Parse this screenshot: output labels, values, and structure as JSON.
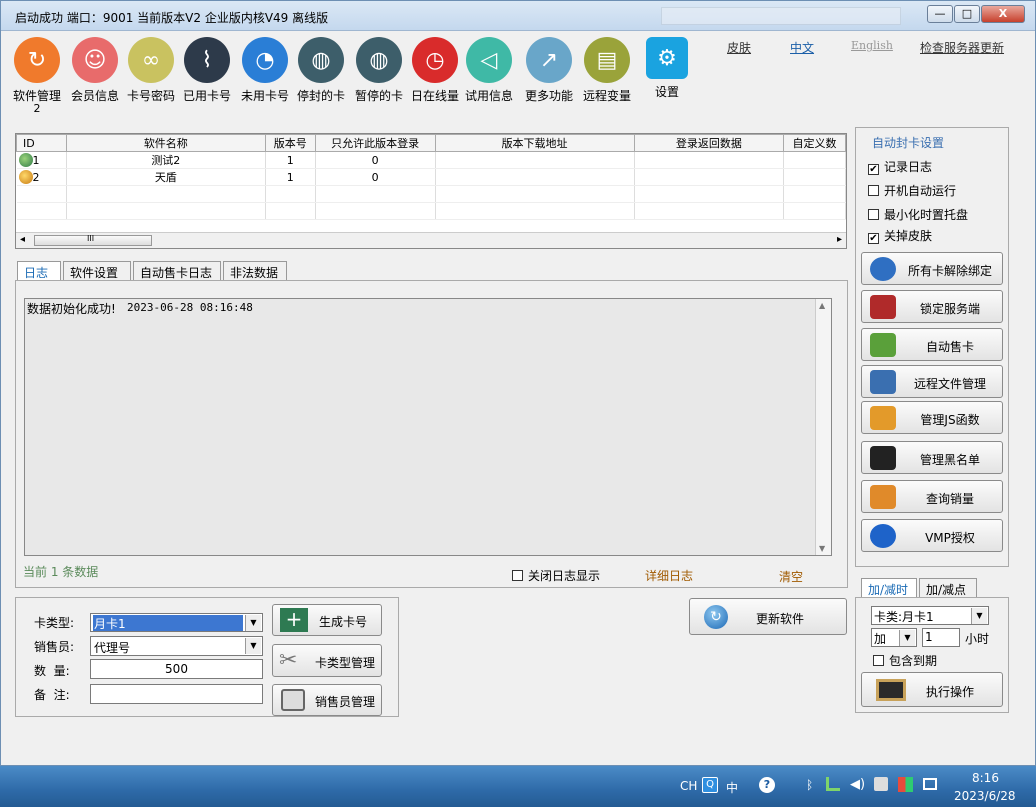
{
  "window": {
    "title": "启动成功  端口：9001  当前版本V2  企业版内核V49    离线版",
    "search_placeholder": "",
    "minimize": "—",
    "maximize": "□",
    "close": "X"
  },
  "toolbar": [
    {
      "label": "软件管理",
      "sub": "2",
      "color": "#f07a2c",
      "icon": "refresh-icon"
    },
    {
      "label": "会员信息",
      "color": "#e86b6b",
      "icon": "users-icon"
    },
    {
      "label": "卡号密码",
      "color": "#c9c260",
      "icon": "chain-icon"
    },
    {
      "label": "已用卡号",
      "color": "#2d3a4a",
      "icon": "paperclip-icon"
    },
    {
      "label": "未用卡号",
      "color": "#2a7ed6",
      "icon": "pie-icon"
    },
    {
      "label": "停封的卡",
      "color": "#3d5e6a",
      "icon": "globe-icon"
    },
    {
      "label": "暂停的卡",
      "color": "#3d5e6a",
      "icon": "globe-icon"
    },
    {
      "label": "日在线量",
      "color": "#d92b2b",
      "icon": "clock-icon"
    },
    {
      "label": "试用信息",
      "color": "#3fb9a6",
      "icon": "megaphone-icon"
    },
    {
      "label": "更多功能",
      "color": "#69a6c9",
      "icon": "chart-icon"
    },
    {
      "label": "远程变量",
      "color": "#9aa33a",
      "icon": "document-icon"
    },
    {
      "label": "设置",
      "color": "#1aa3e0",
      "icon": "gear-icon"
    }
  ],
  "top_links": {
    "skin": "皮肤",
    "chinese": "中文",
    "english": "English",
    "check_update": "检查服务器更新"
  },
  "grid": {
    "columns": [
      "ID",
      "软件名称",
      "版本号",
      "只允许此版本登录",
      "版本下载地址",
      "登录返回数据",
      "自定义数"
    ],
    "rows": [
      {
        "id": "1",
        "name": "测试2",
        "version": "1",
        "only": "0",
        "url": "",
        "ret": "",
        "custom": ""
      },
      {
        "id": "2",
        "name": "天盾",
        "version": "1",
        "only": "0",
        "url": "",
        "ret": "",
        "custom": ""
      }
    ],
    "scroll_left": "◂",
    "scroll_right": "▸",
    "thumb_grip": "III"
  },
  "tabs": [
    "日志",
    "软件设置",
    "自动售卡日志",
    "非法数据"
  ],
  "log": {
    "message": "数据初始化成功!",
    "time": "2023-06-28 08:16:48",
    "count_text": "当前 1 条数据",
    "close_log": "关闭日志显示",
    "detail": "详细日志",
    "clear": "清空"
  },
  "side": {
    "title": "自动封卡设置",
    "checks": [
      {
        "label": "记录日志",
        "checked": true
      },
      {
        "label": "开机自动运行",
        "checked": false
      },
      {
        "label": "最小化时置托盘",
        "checked": false
      },
      {
        "label": "关掉皮肤",
        "checked": true
      }
    ],
    "buttons": [
      {
        "label": "所有卡解除绑定",
        "color": "#2f6fc2"
      },
      {
        "label": "锁定服务端",
        "color": "#b02a2a"
      },
      {
        "label": "自动售卡",
        "color": "#5aa03a"
      },
      {
        "label": "远程文件管理",
        "color": "#3a6fb0"
      },
      {
        "label": "管理JS函数",
        "color": "#e39a2a"
      },
      {
        "label": "管理黑名单",
        "color": "#222222"
      },
      {
        "label": "查询销量",
        "color": "#e08a2a"
      },
      {
        "label": "VMP授权",
        "color": "#1e63c9"
      }
    ]
  },
  "form": {
    "card_type_label": "卡类型:",
    "card_type_value": "月卡1",
    "seller_label": "销售员:",
    "seller_value": "代理号",
    "qty_label": "数  量:",
    "qty_value": "500",
    "note_label": "备  注:",
    "note_value": "",
    "gen_button": "生成卡号",
    "type_button": "卡类型管理",
    "seller_button": "销售员管理"
  },
  "update_button": "更新软件",
  "addsub": {
    "tabs": [
      "加/减时",
      "加/减点"
    ],
    "card_type": "卡类:月卡1",
    "op": "加",
    "amount": "1",
    "unit": "小时",
    "include_expired": "包含到期",
    "exec": "执行操作"
  },
  "taskbar": {
    "lang": "CH",
    "ime": "中",
    "time": "8:16",
    "date": "2023/6/28"
  }
}
